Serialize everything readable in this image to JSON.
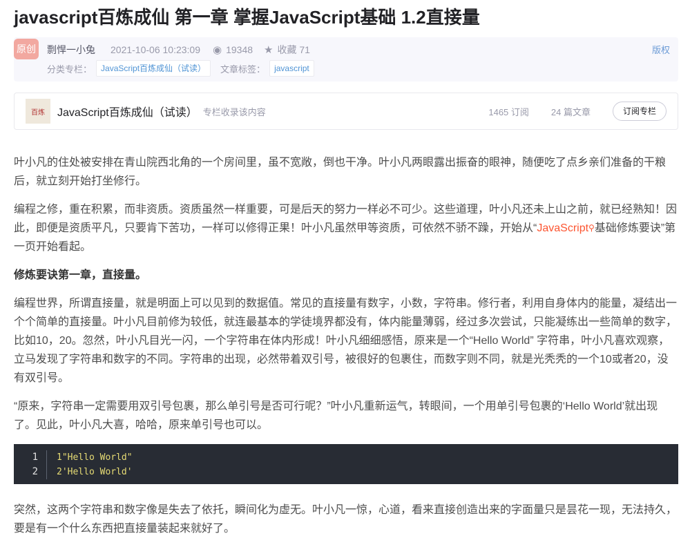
{
  "title": "javascript百炼成仙 第一章 掌握JavaScript基础 1.2直接量",
  "meta": {
    "badge": "原创",
    "author": "剽悍一小兔",
    "date": "2021-10-06 10:23:09",
    "views": "19348",
    "favorites": "收藏 71",
    "copyright": "版权",
    "category_label": "分类专栏：",
    "category": "JavaScript百炼成仙（试读）",
    "tags_label": "文章标签：",
    "tag": "javascript"
  },
  "column": {
    "name": "JavaScript百炼成仙（试读）",
    "note": "专栏收录该内容",
    "subscribers": "1465 订阅",
    "articles": "24 篇文章",
    "subscribe": "订阅专栏"
  },
  "article": {
    "p1": "叶小凡的住处被安排在青山院西北角的一个房间里，虽不宽敞，倒也干净。叶小凡两眼露出振奋的眼神，随便吃了点乡亲们准备的干粮后，就立刻开始打坐修行。",
    "p2a": "编程之修，重在积累，而非资质。资质虽然一样重要，可是后天的努力一样必不可少。这些道理，叶小凡还未上山之前，就已经熟知！因此，即便是资质平凡，只要肯下苦功，一样可以修得正果！叶小凡虽然甲等资质，可依然不骄不躁，开始从“",
    "p2link": "JavaScript",
    "p2b": "基础修炼要诀”第一页开始看起。",
    "h": "修炼要诀第一章，直接量。",
    "p4": "编程世界，所谓直接量，就是明面上可以见到的数据值。常见的直接量有数字，小数，字符串。修行者，利用自身体内的能量，凝结出一个个简单的直接量。叶小凡目前修为较低，就连最基本的学徒境界都没有，体内能量薄弱，经过多次尝试，只能凝练出一些简单的数字，比如10，20。忽然，叶小凡目光一闪，一个字符串在体内形成！叶小凡细细感悟，原来是一个“Hello World” 字符串，叶小凡喜欢观察，立马发现了字符串和数字的不同。字符串的出现，必然带着双引号，被很好的包裹住，而数字则不同，就是光秃秃的一个10或者20，没有双引号。",
    "p5": "“原来，字符串一定需要用双引号包裹，那么单引号是否可行呢？”叶小凡重新运气，转眼间，一个用单引号包裹的‘Hello World’就出现了。见此，叶小凡大喜，哈哈，原来单引号也可以。",
    "code": [
      {
        "n": "1",
        "t": "1\"Hello World\""
      },
      {
        "n": "2",
        "t": "2'Hello World'"
      }
    ],
    "p6": "突然，这两个字符串和数字像是失去了依托，瞬间化为虚无。叶小凡一惊，心道，看来直接创造出来的字面量只是昙花一现，无法持久，要是有一个什么东西把直接量装起来就好了。"
  }
}
